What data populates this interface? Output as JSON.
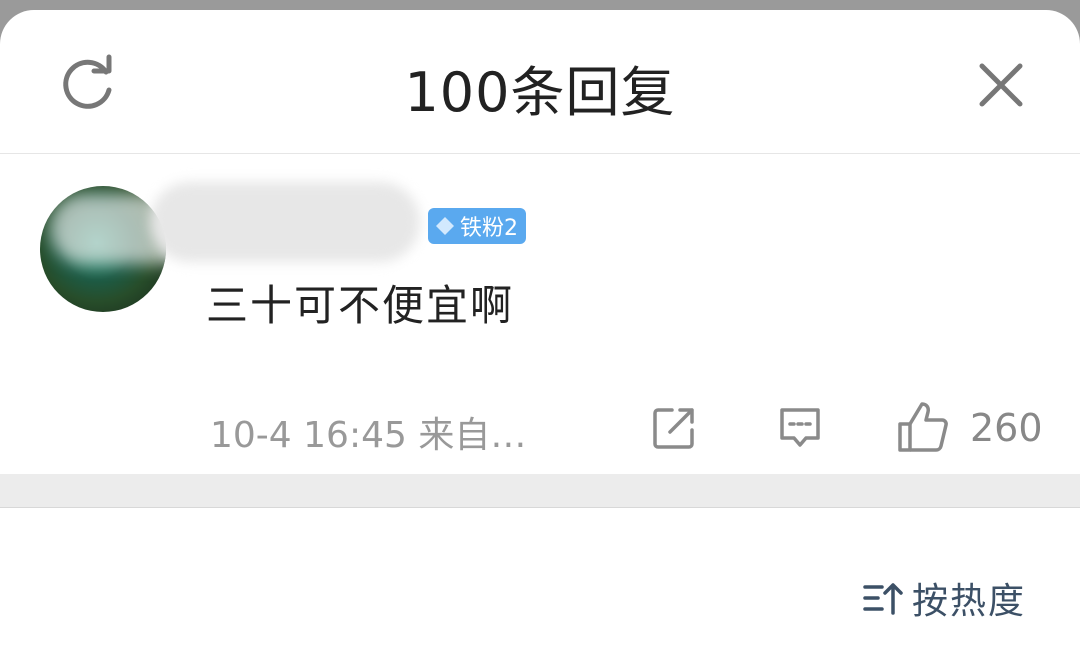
{
  "header": {
    "title": "100条回复",
    "refresh_icon": "refresh-icon",
    "close_icon": "close-icon"
  },
  "comment": {
    "badge": "铁粉2",
    "text": "三十可不便宜啊",
    "time": "10-4 16:45",
    "source": "来自…",
    "like_count": "260"
  },
  "sort": {
    "label": "按热度"
  },
  "colors": {
    "badge_bg": "#5aa9ef",
    "sort_text": "#3c5066"
  }
}
